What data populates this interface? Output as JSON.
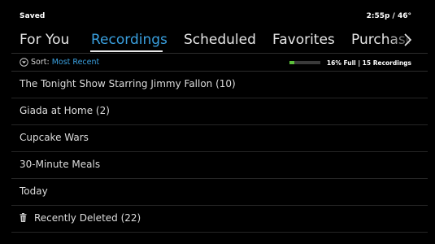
{
  "header": {
    "title": "Saved",
    "time_weather": "2:55p / 46°"
  },
  "tabs": [
    {
      "label": "For You",
      "active": false
    },
    {
      "label": "Recordings",
      "active": true
    },
    {
      "label": "Scheduled",
      "active": false
    },
    {
      "label": "Favorites",
      "active": false
    },
    {
      "label": "Purchases",
      "active": false
    }
  ],
  "sort": {
    "label": "Sort:",
    "value": "Most Recent"
  },
  "storage": {
    "percent_full": 0.16,
    "text": "16% Full | 15 Recordings"
  },
  "recordings": [
    {
      "label": "The Tonight Show Starring Jimmy Fallon (10)"
    },
    {
      "label": "Giada at Home (2)"
    },
    {
      "label": "Cupcake Wars"
    },
    {
      "label": "30-Minute Meals"
    },
    {
      "label": "Today"
    },
    {
      "label": "Recently Deleted (22)",
      "icon": "trash-icon"
    }
  ],
  "colors": {
    "accent": "#3aa0df",
    "storage_fill": "#5bbf3a",
    "background": "#000000"
  }
}
